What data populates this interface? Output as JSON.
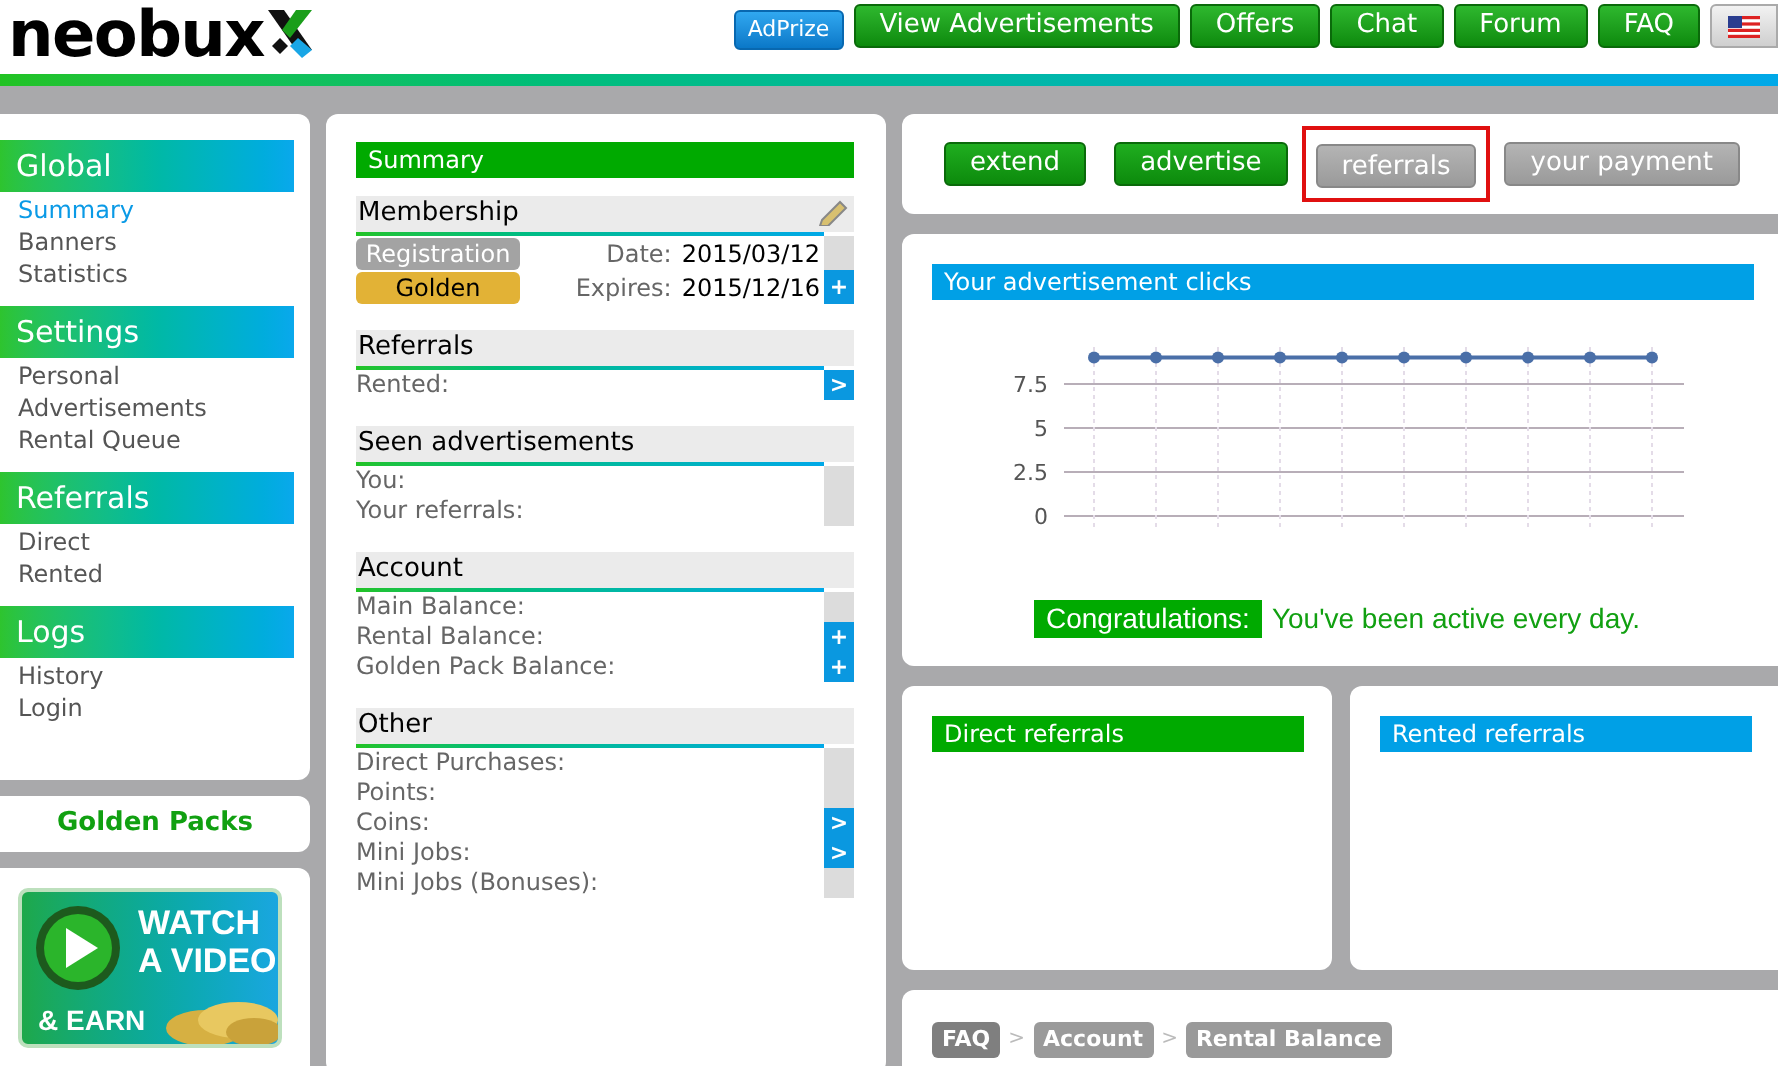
{
  "header": {
    "logo": "neobux",
    "nav": [
      {
        "kind": "blue",
        "label": "AdPrize"
      },
      {
        "kind": "green",
        "label": "View Advertisements"
      },
      {
        "kind": "green",
        "label": "Offers"
      },
      {
        "kind": "green",
        "label": "Chat"
      },
      {
        "kind": "green",
        "label": "Forum"
      },
      {
        "kind": "green",
        "label": "FAQ"
      },
      {
        "kind": "flag"
      }
    ]
  },
  "sidebar": {
    "groups": [
      {
        "title": "Global",
        "items": [
          {
            "label": "Summary",
            "selected": true
          },
          {
            "label": "Banners",
            "selected": false
          },
          {
            "label": "Statistics",
            "selected": false
          }
        ]
      },
      {
        "title": "Settings",
        "items": [
          {
            "label": "Personal",
            "selected": false
          },
          {
            "label": "Advertisements",
            "selected": false
          },
          {
            "label": "Rental Queue",
            "selected": false
          }
        ]
      },
      {
        "title": "Referrals",
        "items": [
          {
            "label": "Direct",
            "selected": false
          },
          {
            "label": "Rented",
            "selected": false
          }
        ]
      },
      {
        "title": "Logs",
        "items": [
          {
            "label": "History",
            "selected": false
          },
          {
            "label": "Login",
            "selected": false
          }
        ]
      }
    ]
  },
  "golden_packs": "Golden Packs",
  "promo_banner": {
    "lines": [
      "WATCH",
      "A VIDEO",
      "& EARN"
    ]
  },
  "summary": {
    "title": "Summary",
    "sections": [
      {
        "kind": "membership",
        "title": "Membership",
        "rows": [
          {
            "badge": "Registration",
            "color": "#a3a3a3",
            "label": "Date:",
            "value": "2015/03/12"
          },
          {
            "badge": "Golden",
            "color": "#e2b236",
            "label": "Expires:",
            "value": "2015/12/16",
            "action": "+"
          }
        ]
      },
      {
        "kind": "list",
        "title": "Referrals",
        "rows": [
          {
            "label": "Rented:",
            "action": ">"
          }
        ]
      },
      {
        "kind": "list",
        "title": "Seen advertisements",
        "rows": [
          {
            "label": "You:"
          },
          {
            "label": "Your referrals:"
          }
        ]
      },
      {
        "kind": "list",
        "title": "Account",
        "rows": [
          {
            "label": "Main Balance:"
          },
          {
            "label": "Rental Balance:",
            "action": "+"
          },
          {
            "label": "Golden Pack Balance:",
            "action": "+"
          }
        ]
      },
      {
        "kind": "list",
        "title": "Other",
        "rows": [
          {
            "label": "Direct Purchases:"
          },
          {
            "label": "Points:"
          },
          {
            "label": "Coins:",
            "action": ">"
          },
          {
            "label": "Mini Jobs:",
            "action": ">"
          },
          {
            "label": "Mini Jobs (Bonuses):"
          }
        ]
      }
    ]
  },
  "actions": [
    {
      "label": "extend",
      "kind": "primary",
      "highlighted": false
    },
    {
      "label": "advertise",
      "kind": "primary",
      "highlighted": false
    },
    {
      "label": "referrals",
      "kind": "secondary",
      "highlighted": true
    },
    {
      "label": "your payment",
      "kind": "secondary",
      "highlighted": false
    }
  ],
  "clicks": {
    "title": "Your advertisement clicks",
    "chart_data": {
      "type": "line",
      "ylim": [
        -0.8,
        9.6
      ],
      "yticks": [
        0,
        2.5,
        5,
        7.5
      ],
      "grid": true,
      "series": [
        {
          "color": "#4a6fa8",
          "marker": "circle",
          "values": [
            9,
            9,
            9,
            9,
            9,
            9,
            9,
            9,
            9,
            9
          ]
        }
      ]
    },
    "congrats_label": "Congratulations:",
    "congrats_text": "You've been active every day."
  },
  "referral_panels": [
    {
      "title": "Direct referrals",
      "color": "#00aa00"
    },
    {
      "title": "Rented referrals",
      "color": "#00a0e6"
    }
  ],
  "breadcrumb": {
    "items": [
      "FAQ",
      "Account",
      "Rental Balance"
    ],
    "separators": [
      ">",
      ">"
    ]
  }
}
